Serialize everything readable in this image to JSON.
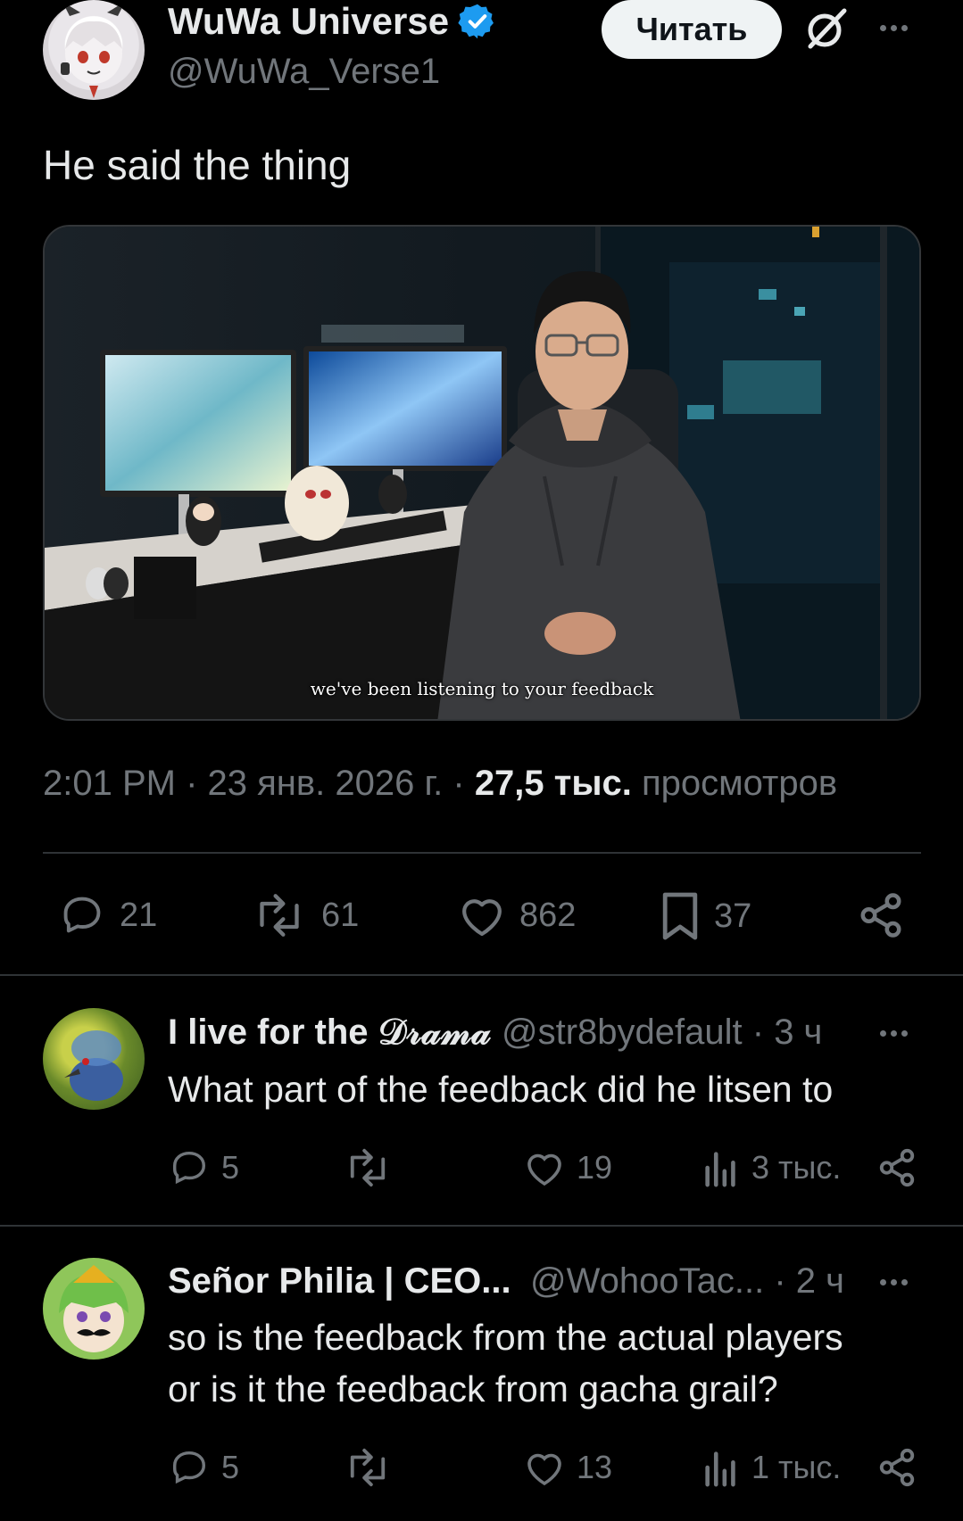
{
  "post": {
    "author_name": "WuWa Universe",
    "author_handle": "@WuWa_Verse1",
    "verified_icon": "verified-badge-icon",
    "follow_label": "Читать",
    "text": "He said the thing",
    "video_subtitle": "we've been listening to your feedback",
    "time": "2:01 PM",
    "date": "23 янв. 2026 г.",
    "views_count": "27,5 тыс.",
    "views_label": "просмотров",
    "separator": " · ",
    "stats": {
      "replies": "21",
      "reposts": "61",
      "likes": "862",
      "bookmarks": "37"
    }
  },
  "replies": [
    {
      "name": "I live for the 𝒟𝓇𝒶𝓂𝒶",
      "handle": "@str8bydefault",
      "time": "· 3 ч",
      "text": "What part of the feedback did he litsen to",
      "replies": "5",
      "likes": "19",
      "views": "3 тыс."
    },
    {
      "name": "Señor Philia | CEO...",
      "handle": "@WohooTac...",
      "time": "· 2 ч",
      "text_line1": "so is the feedback from the actual players",
      "text_line2": "or is it the feedback from gacha grail?",
      "replies": "5",
      "likes": "13",
      "views": "1 тыс."
    }
  ],
  "colors": {
    "background": "#000000",
    "text_primary": "#e7e9ea",
    "text_secondary": "#71767b",
    "verified_blue": "#1d9bf0",
    "divider": "#2f3336"
  }
}
